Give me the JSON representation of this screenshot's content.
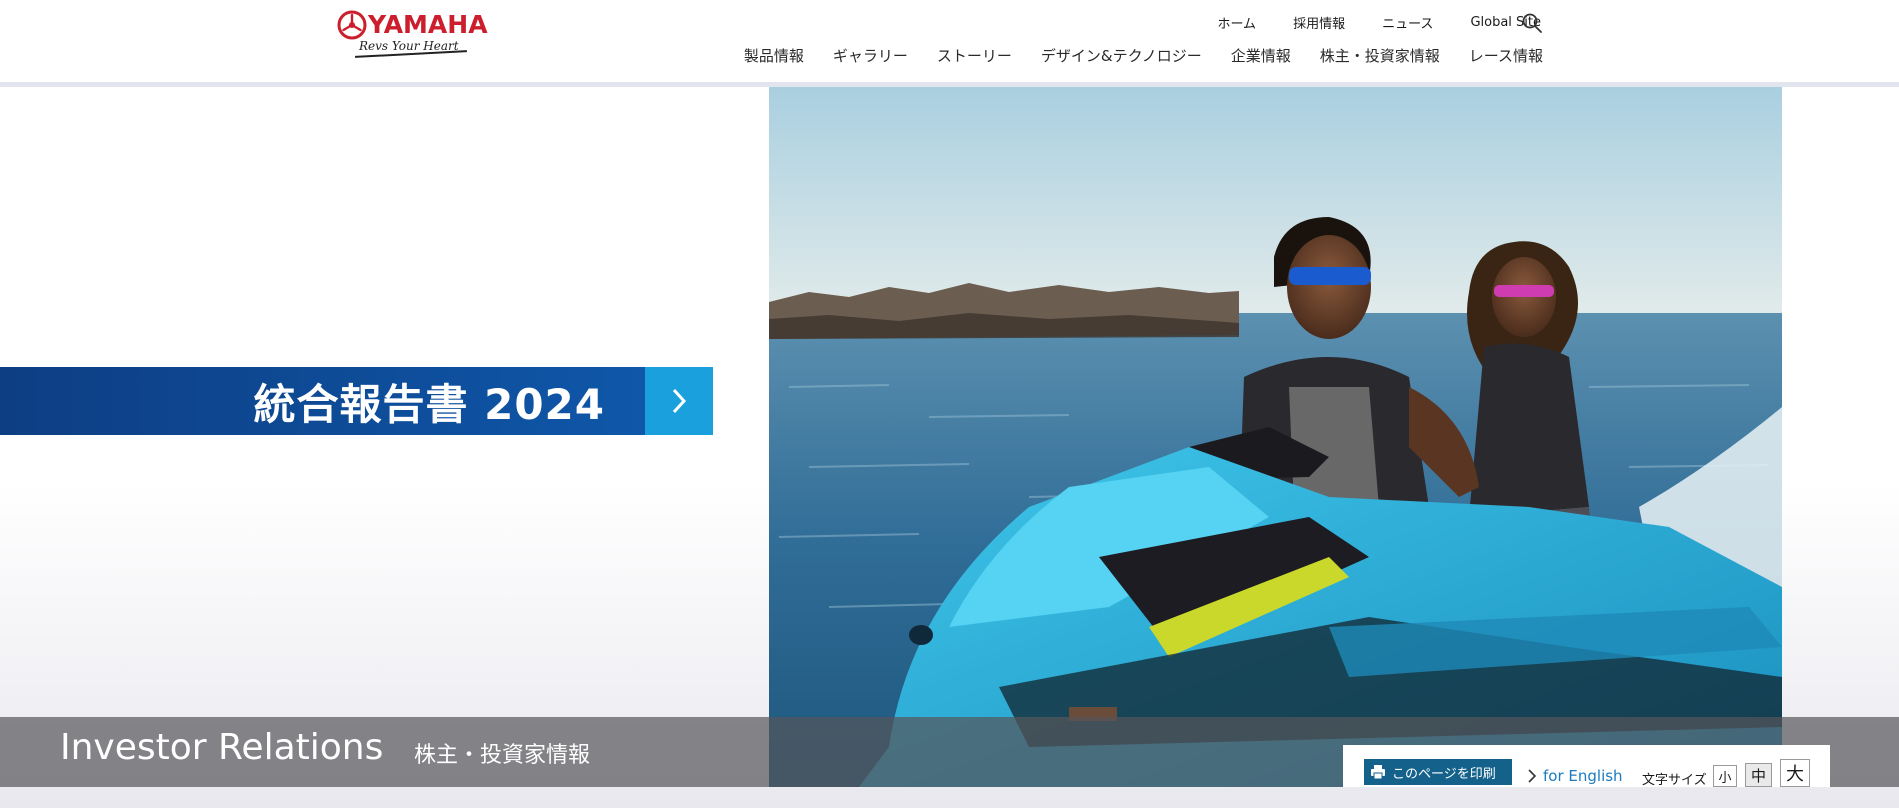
{
  "header": {
    "logo_text": "YAMAHA",
    "logo_tagline": "Revs Your Heart",
    "utility_nav": [
      "ホーム",
      "採用情報",
      "ニュース",
      "Global Site"
    ],
    "main_nav": [
      "製品情報",
      "ギャラリー",
      "ストーリー",
      "デザイン&テクノロジー",
      "企業情報",
      "株主・投資家情報",
      "レース情報"
    ],
    "search_icon": "search-icon",
    "brand_color": "#cc1e2c"
  },
  "hero": {
    "banner_label": "統合報告書 2024",
    "banner_colors": {
      "label": "#0f57a9",
      "arrow": "#1ba0de"
    },
    "photo": "Two riders on a blue personal watercraft at sea"
  },
  "ir": {
    "title": "Investor Relations",
    "subtitle": "株主・投資家情報"
  },
  "tools": {
    "print_label": "このページを印刷",
    "english_label": "for English",
    "font_size_label": "文字サイズ",
    "font_sizes": [
      "小",
      "中",
      "大"
    ],
    "selected_font_size": "中"
  }
}
